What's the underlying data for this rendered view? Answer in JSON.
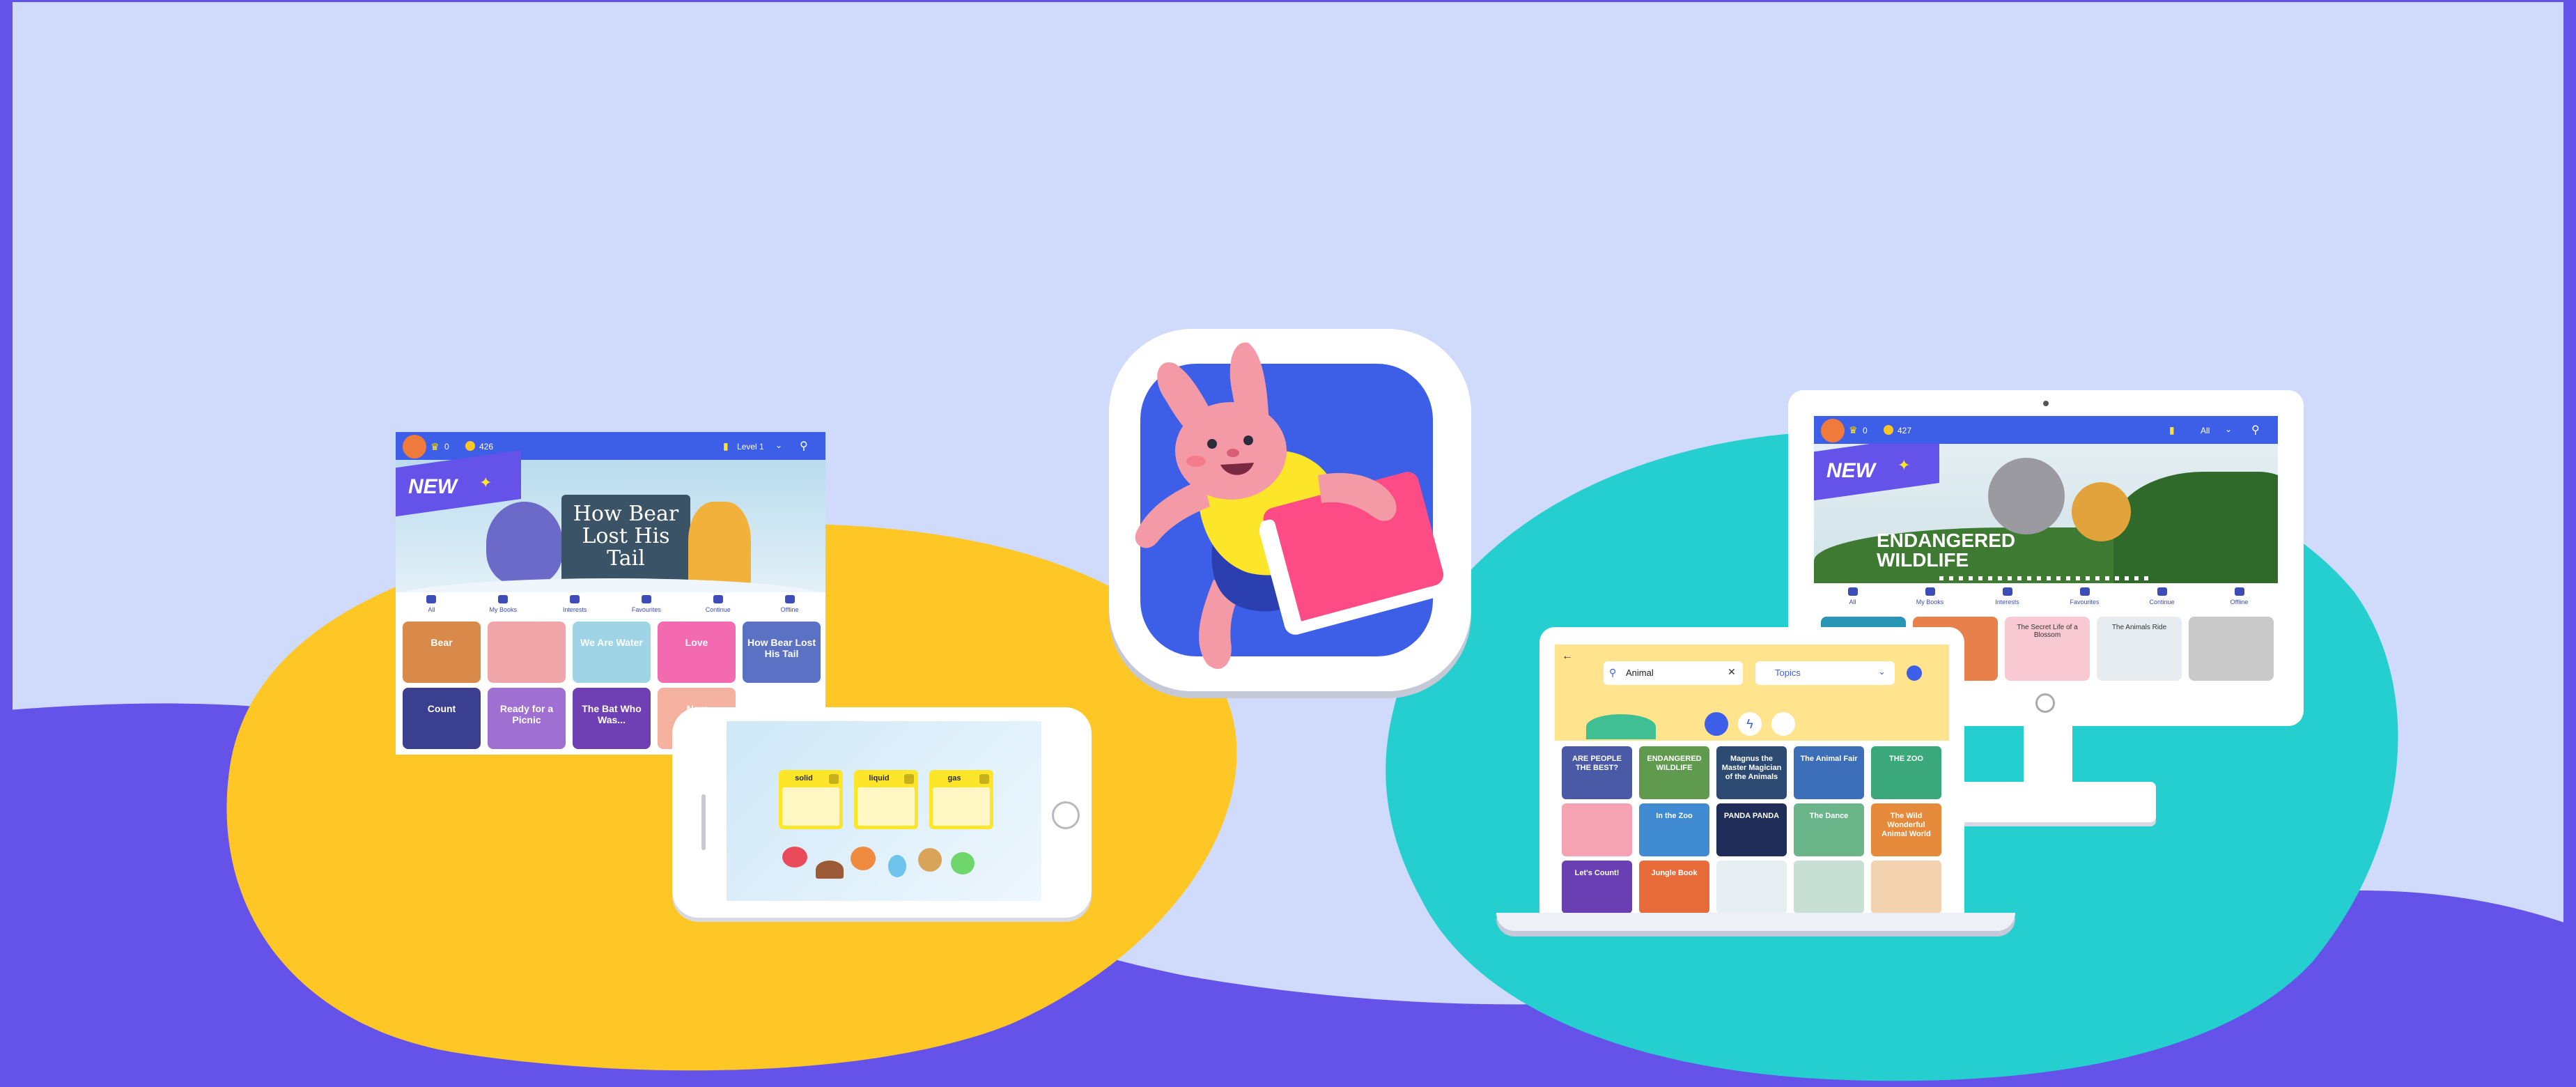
{
  "colors": {
    "background": "#d0dafa",
    "wave_purple": "#6552e8",
    "blob_yellow": "#fec726",
    "blob_teal": "#25cfd0",
    "app_blue": "#3d5fe8",
    "bunny_pink": "#f49aa6",
    "book_pink": "#fc4b85",
    "shirt_yellow": "#fde52a"
  },
  "tablet": {
    "stars": "0",
    "coins": "426",
    "level": "Level 1",
    "badge": "NEW",
    "banner_title": "How Bear Lost His Tail",
    "nav": [
      "All",
      "My Books",
      "Interests",
      "Favourites",
      "Continue",
      "Offline"
    ],
    "books": [
      {
        "label": "Bear"
      },
      {
        "label": ""
      },
      {
        "label": "We Are Water"
      },
      {
        "label": "Love"
      },
      {
        "label": "How Bear Lost His Tail"
      },
      {
        "label": "Count"
      },
      {
        "label": "Ready for a Picnic"
      },
      {
        "label": "The Bat Who Was..."
      },
      {
        "label": "New"
      }
    ]
  },
  "phone": {
    "states": [
      "solid",
      "liquid",
      "gas"
    ]
  },
  "monitor": {
    "stars": "0",
    "coins": "427",
    "filter": "All",
    "badge": "NEW",
    "banner_title": "ENDANGERED WILDLIFE",
    "nav": [
      "All",
      "My Books",
      "Interests",
      "Favourites",
      "Continue",
      "Offline"
    ],
    "books": [
      "",
      "",
      "The Secret Life of a Blossom",
      "The Animals Ride",
      ""
    ]
  },
  "laptop": {
    "search_value": "Animal",
    "filter_value": "Topics",
    "books": [
      "ARE PEOPLE THE BEST?",
      "ENDANGERED WILDLIFE",
      "Magnus the Master Magician of the Animals",
      "The Animal Fair",
      "THE ZOO",
      "",
      "In the Zoo",
      "PANDA PANDA",
      "The Dance",
      "The Wild Wonderful Animal World",
      "Let's Count!",
      "Jungle Book",
      "",
      "",
      ""
    ]
  }
}
